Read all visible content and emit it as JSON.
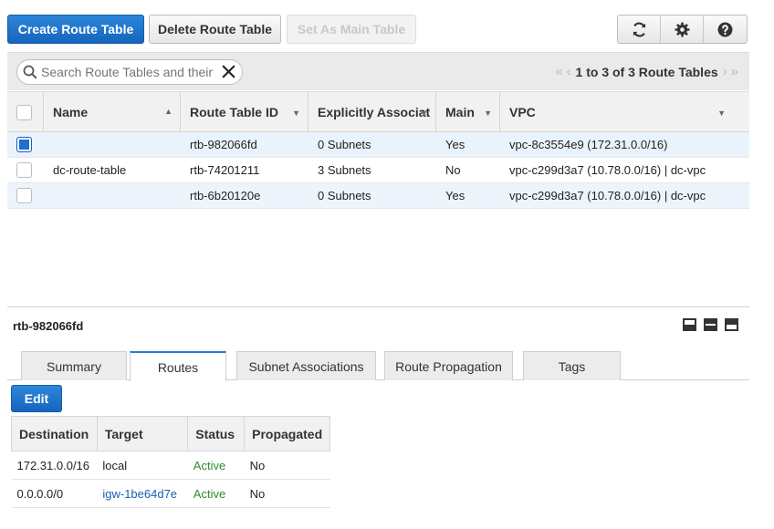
{
  "toolbar": {
    "create_label": "Create Route Table",
    "delete_label": "Delete Route Table",
    "set_main_label": "Set As Main Table"
  },
  "icons": {
    "refresh": "refresh-icon",
    "settings": "gear-icon",
    "help": "help-icon"
  },
  "search": {
    "placeholder": "Search Route Tables and their"
  },
  "pager": {
    "text": "1 to 3 of 3 Route Tables"
  },
  "table": {
    "columns": [
      "Name",
      "Route Table ID",
      "Explicitly Associat",
      "Main",
      "VPC"
    ],
    "rows": [
      {
        "selected": true,
        "name": "",
        "id": "rtb-982066fd",
        "assoc": "0 Subnets",
        "main": "Yes",
        "vpc": "vpc-8c3554e9 (172.31.0.0/16)"
      },
      {
        "selected": false,
        "name": "dc-route-table",
        "id": "rtb-74201211",
        "assoc": "3 Subnets",
        "main": "No",
        "vpc": "vpc-c299d3a7 (10.78.0.0/16) | dc-vpc"
      },
      {
        "selected": false,
        "name": "",
        "id": "rtb-6b20120e",
        "assoc": "0 Subnets",
        "main": "Yes",
        "vpc": "vpc-c299d3a7 (10.78.0.0/16) | dc-vpc"
      }
    ]
  },
  "details": {
    "title": "rtb-982066fd",
    "tabs": [
      "Summary",
      "Routes",
      "Subnet Associations",
      "Route Propagation",
      "Tags"
    ],
    "active_tab": "Routes",
    "edit_label": "Edit",
    "routes": {
      "columns": [
        "Destination",
        "Target",
        "Status",
        "Propagated"
      ],
      "rows": [
        {
          "destination": "172.31.0.0/16",
          "target": "local",
          "status": "Active",
          "propagated": "No"
        },
        {
          "destination": "0.0.0.0/0",
          "target": "igw-1be64d7e",
          "status": "Active",
          "propagated": "No"
        }
      ]
    }
  },
  "colors": {
    "primary": "#1f6fd1",
    "active_status": "#2f8a2f",
    "link": "#1a5fb4"
  }
}
